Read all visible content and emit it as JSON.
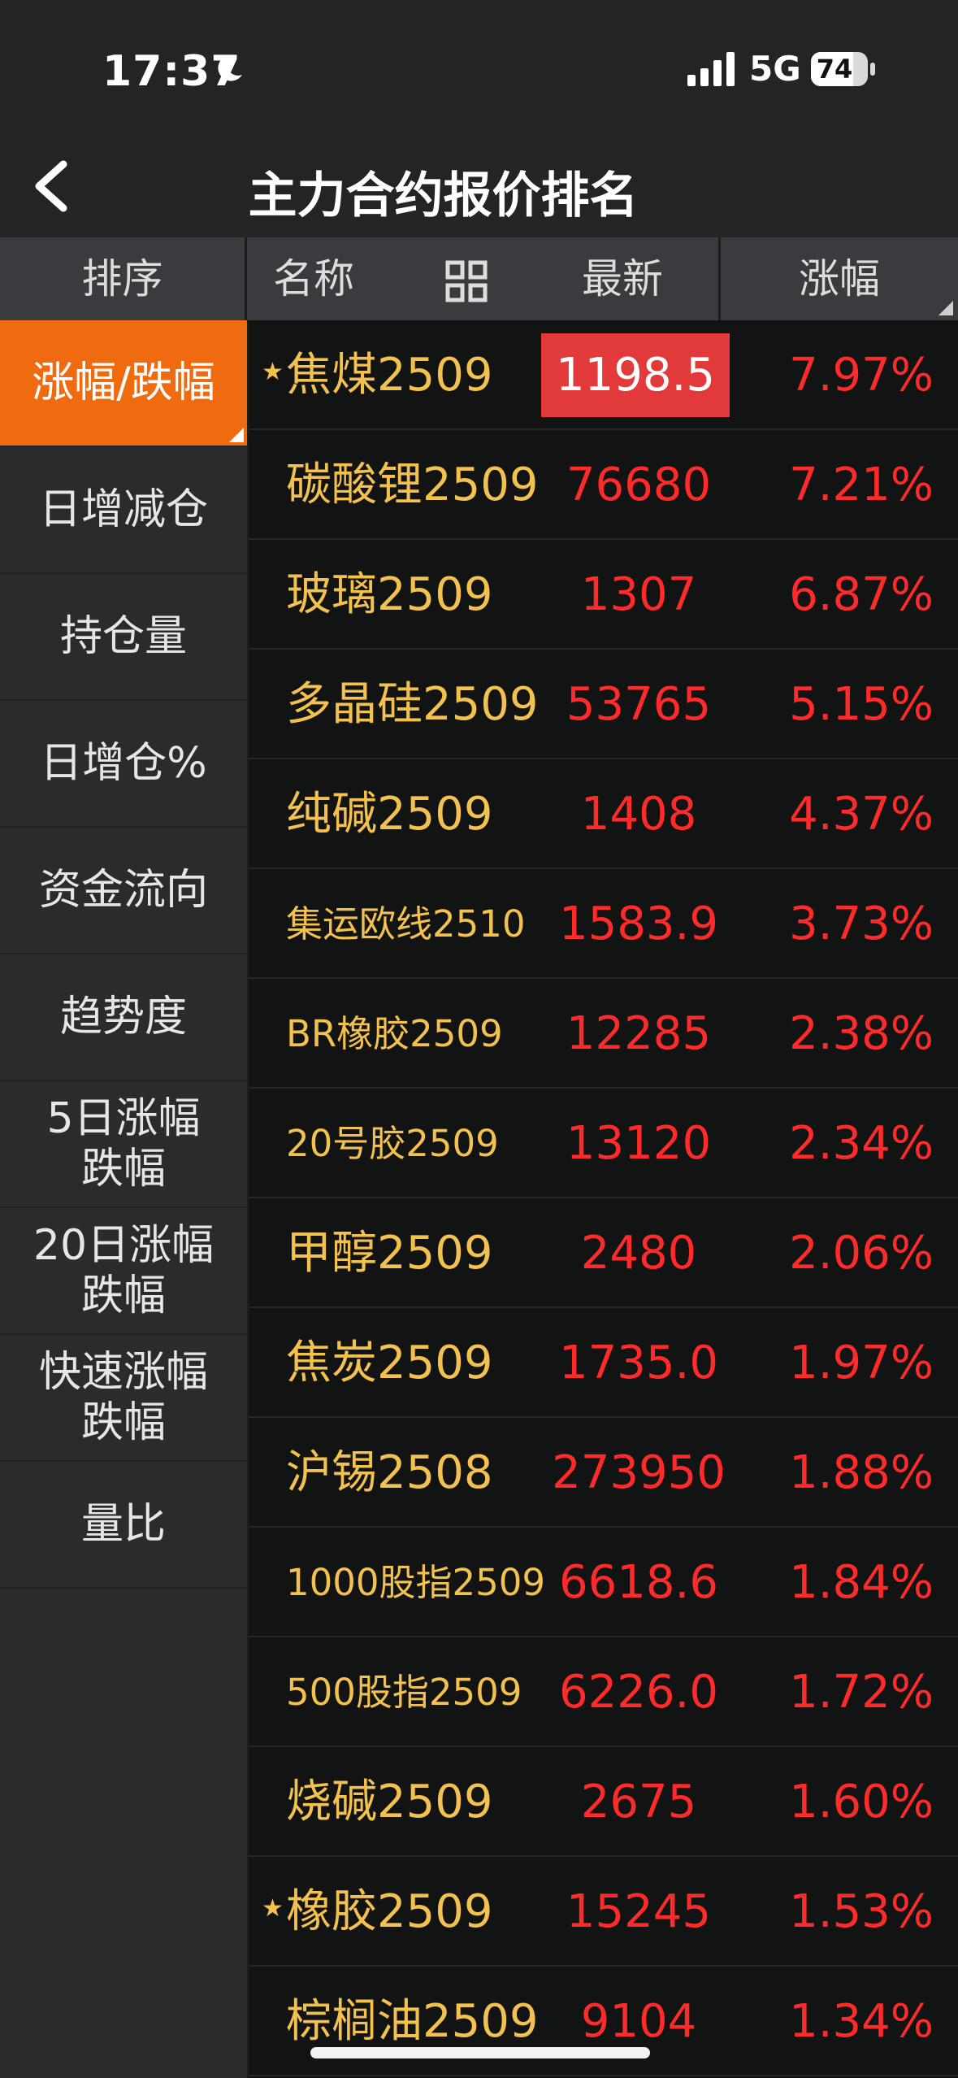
{
  "status": {
    "time": "17:37",
    "network": "5G",
    "battery": "74",
    "battery_level": 0.74
  },
  "nav": {
    "title": "主力合约报价排名"
  },
  "header": {
    "sort": "排序",
    "name": "名称",
    "latest": "最新",
    "change": "涨幅"
  },
  "sidebar": {
    "items": [
      {
        "label": "涨幅/跌幅",
        "active": true
      },
      {
        "label": "日增减仓"
      },
      {
        "label": "持仓量"
      },
      {
        "label": "日增仓%"
      },
      {
        "label": "资金流向"
      },
      {
        "label": "趋势度"
      },
      {
        "label": "5日涨幅\n跌幅"
      },
      {
        "label": "20日涨幅\n跌幅"
      },
      {
        "label": "快速涨幅\n跌幅"
      },
      {
        "label": "量比"
      }
    ]
  },
  "rows": [
    {
      "name": "焦煤2509",
      "price": "1198.5",
      "change": "7.97%",
      "star": true,
      "highlight": true
    },
    {
      "name": "碳酸锂2509",
      "price": "76680",
      "change": "7.21%"
    },
    {
      "name": "玻璃2509",
      "price": "1307",
      "change": "6.87%"
    },
    {
      "name": "多晶硅2509",
      "price": "53765",
      "change": "5.15%"
    },
    {
      "name": "纯碱2509",
      "price": "1408",
      "change": "4.37%"
    },
    {
      "name": "集运欧线2510",
      "price": "1583.9",
      "change": "3.73%",
      "small": true
    },
    {
      "name": "BR橡胶2509",
      "price": "12285",
      "change": "2.38%",
      "small": true
    },
    {
      "name": "20号胶2509",
      "price": "13120",
      "change": "2.34%",
      "small": true
    },
    {
      "name": "甲醇2509",
      "price": "2480",
      "change": "2.06%"
    },
    {
      "name": "焦炭2509",
      "price": "1735.0",
      "change": "1.97%"
    },
    {
      "name": "沪锡2508",
      "price": "273950",
      "change": "1.88%"
    },
    {
      "name": "1000股指2509",
      "price": "6618.6",
      "change": "1.84%",
      "small": true
    },
    {
      "name": "500股指2509",
      "price": "6226.0",
      "change": "1.72%",
      "small": true
    },
    {
      "name": "烧碱2509",
      "price": "2675",
      "change": "1.60%"
    },
    {
      "name": "橡胶2509",
      "price": "15245",
      "change": "1.53%",
      "star": true
    },
    {
      "name": "棕榈油2509",
      "price": "9104",
      "change": "1.34%"
    }
  ],
  "colors": {
    "accent": "#f06a0f",
    "up": "#ff2a2a",
    "name": "#f3c14e",
    "highlight": "#e23a3a"
  }
}
